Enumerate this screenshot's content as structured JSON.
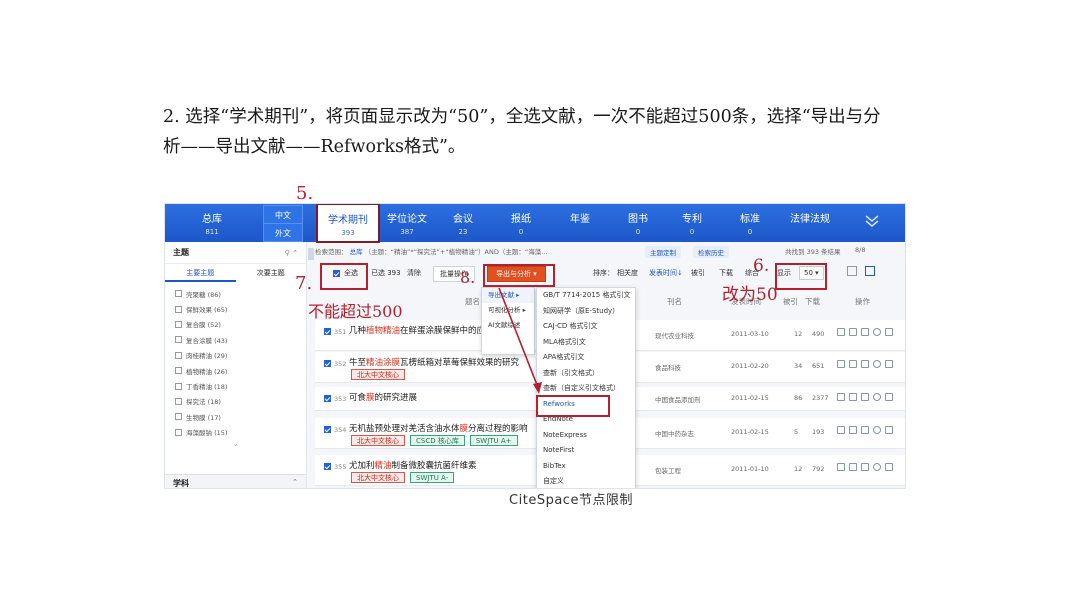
{
  "instruction": {
    "line1": "2. 选择“学术期刊”，将页面显示改为“50”，全选文献，一次不能超过500条，选择“导出与分",
    "line2": "析——导出文献——Refworks格式”。"
  },
  "nav": {
    "items": [
      {
        "label": "总库",
        "count": "811"
      },
      {
        "label": "学术期刊",
        "count": "393"
      },
      {
        "label": "学位论文",
        "count": "387"
      },
      {
        "label": "会议",
        "count": "23"
      },
      {
        "label": "报纸",
        "count": "0"
      },
      {
        "label": "年鉴",
        "count": ""
      },
      {
        "label": "图书",
        "count": "0"
      },
      {
        "label": "专利",
        "count": "0"
      },
      {
        "label": "标准",
        "count": "0"
      },
      {
        "label": "法律法规",
        "count": ""
      }
    ],
    "lang_cn": "中文",
    "lang_foreign": "外文"
  },
  "sidebar": {
    "title": "主题",
    "tab_main": "主要主题",
    "tab_sub": "次要主题",
    "items": [
      "壳聚糖 (86)",
      "保鲜效果 (65)",
      "复合膜 (52)",
      "复合涂膜 (43)",
      "肉桂精油 (29)",
      "植物精油 (26)",
      "丁香精油 (18)",
      "探究法 (18)",
      "生物膜 (17)",
      "海藻酸钠 (15)"
    ],
    "footer_title": "学科"
  },
  "search": {
    "scope_label": "检索范围：",
    "scope_value": "总库",
    "query": "（主题：“精油”*“探究法”+“植物精油”）AND（主题：“海藻...",
    "save_btn": "主题定制",
    "history_btn": "检索历史",
    "result_text": "共找到 393 条结果",
    "page_text": "8/8"
  },
  "toolbar": {
    "select_all": "全选",
    "selected": "已选 393",
    "clear": "清除",
    "batch": "批量操作",
    "export": "导出与分析",
    "sort_label": "排序：",
    "sort_relevance": "相关度",
    "sort_date": "发表时间",
    "sort_cited": "被引",
    "sort_download": "下载",
    "sort_composite": "综合",
    "display_label": "显示",
    "display_value": "50"
  },
  "columns": {
    "title": "题名",
    "source": "刊名",
    "date": "发表时间",
    "cited": "被引",
    "download": "下载",
    "ops": "操作"
  },
  "rows": [
    {
      "idx": "351",
      "title_a": "几种",
      "title_hl": "植物精油",
      "title_b": "在鲜蛋涂膜保鲜中的应用研究",
      "tags": [],
      "source": "现代农业科技",
      "date": "2011-03-10",
      "cited": "12",
      "downloads": "490"
    },
    {
      "idx": "352",
      "title_a": "牛至",
      "title_hl": "精油涂膜",
      "title_b": "瓦楞纸箱对草莓保鲜效果的研究",
      "tags": [
        {
          "text": "北大中文核心",
          "color": "red"
        }
      ],
      "source": "食品科技",
      "date": "2011-02-20",
      "cited": "34",
      "downloads": "651"
    },
    {
      "idx": "353",
      "title_a": "可食",
      "title_hl": "膜",
      "title_b": "的研究进展",
      "tags": [],
      "source": "中国食品添加剂",
      "date": "2011-02-15",
      "cited": "86",
      "downloads": "2377"
    },
    {
      "idx": "354",
      "title_a": "无机盐预处理对羌活含油水体",
      "title_hl": "膜",
      "title_b": "分离过程的影响",
      "tags": [
        {
          "text": "北大中文核心",
          "color": "red"
        },
        {
          "text": "CSCD 核心库",
          "color": "green"
        },
        {
          "text": "SWJTU A+",
          "color": "green"
        }
      ],
      "source": "中国中药杂志",
      "date": "2011-02-15",
      "cited": "5",
      "downloads": "193"
    },
    {
      "idx": "355",
      "title_a": "尤加利",
      "title_hl": "精油",
      "title_b": "制备微胶囊抗菌纤维素",
      "tags": [
        {
          "text": "北大中文核心",
          "color": "red"
        },
        {
          "text": "SWJTU A-",
          "color": "green"
        }
      ],
      "source": "包装工程",
      "date": "2011-01-10",
      "cited": "12",
      "downloads": "792"
    }
  ],
  "export_menu": [
    "导出文献",
    "可视化分析",
    "AI文献综述"
  ],
  "format_menu": [
    "GB/T 7714-2015 格式引文",
    "知网研学（原E-Study）",
    "CAJ-CD 格式引文",
    "MLA格式引文",
    "APA格式引文",
    "查新（引文格式）",
    "查新（自定义引文格式）",
    "Refworks",
    "EndNote",
    "NoteExpress",
    "NoteFirst",
    "BibTex",
    "自定义"
  ],
  "annotations": {
    "step5": "5.",
    "step6": "6.",
    "step7": "7.",
    "step8": "8.",
    "limit": "不能超过500",
    "change50": "改为50"
  },
  "caption": "CiteSpace节点限制",
  "colors": {
    "accent": "#1d57c9",
    "annotation": "#b3202f",
    "export_button": "#e05020"
  }
}
